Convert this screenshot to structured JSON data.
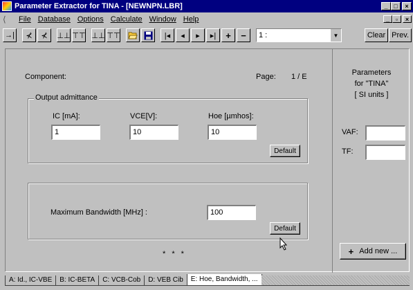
{
  "window": {
    "title": "Parameter Extractor for TINA - [NEWNPN.LBR]",
    "caption_buttons": [
      "_",
      "□",
      "×"
    ],
    "mdi_caption_buttons": [
      "_",
      "▫",
      "×"
    ]
  },
  "menubar": {
    "items": [
      "File",
      "Database",
      "Options",
      "Calculate",
      "Window",
      "Help"
    ]
  },
  "toolbar": {
    "tool_icons": [
      "→|",
      "⊀",
      "⊀",
      "⊥⊥",
      "⊤⊤",
      "⊥⊥",
      "⊤⊤",
      "folder-open-icon",
      "save-icon",
      "|◂",
      "◂",
      "▸",
      "▸|",
      "+",
      "−"
    ],
    "page_select_value": "1 :",
    "clear_label": "Clear",
    "prev_label": "Prev."
  },
  "main": {
    "component_label": "Component:",
    "page_label": "Page:",
    "page_value": "1 / E",
    "output_group": {
      "caption": "Output admittance",
      "ic_label": "IC [mA]:",
      "ic_value": "1",
      "vce_label": "VCE[V]:",
      "vce_value": "10",
      "hoe_label": "Hoe [µmhos]:",
      "hoe_value": "10",
      "default_label": "Default"
    },
    "bandwidth_group": {
      "label": "Maximum Bandwidth   [MHz] :",
      "value": "100",
      "default_label": "Default"
    },
    "stars": "* * *"
  },
  "side": {
    "heading_line1": "Parameters",
    "heading_line2": "for \"TINA\"",
    "heading_line3": "[ SI units ]",
    "vaf_label": "VAF:",
    "vaf_value": "",
    "tf_label": "TF:",
    "tf_value": "",
    "add_new_label": "Add new ..."
  },
  "tabs": [
    {
      "label": "A: Id.,  IC-VBE",
      "active": false
    },
    {
      "label": "B: IC-BETA",
      "active": false
    },
    {
      "label": "C: VCB-Cob",
      "active": false
    },
    {
      "label": "D: VEB Cib",
      "active": false
    },
    {
      "label": "E: Hoe, Bandwidth, ...",
      "active": true
    }
  ]
}
